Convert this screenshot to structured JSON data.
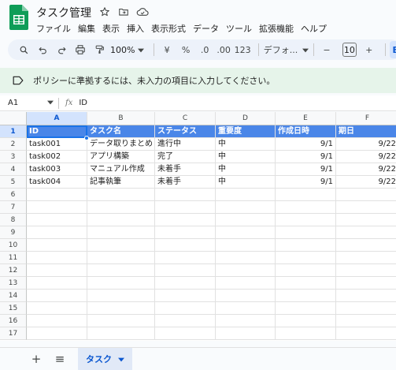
{
  "app": {
    "title": "タスク管理",
    "menu": [
      "ファイル",
      "編集",
      "表示",
      "挿入",
      "表示形式",
      "データ",
      "ツール",
      "拡張機能",
      "ヘルプ"
    ]
  },
  "toolbar": {
    "zoom": "100%",
    "currency": "¥",
    "percent": "%",
    "decrease_decimal": ".0",
    "increase_decimal": ".00",
    "number_format": "123",
    "font": "デフォ...",
    "font_size": "10",
    "minus": "−",
    "plus": "+",
    "bold": "B"
  },
  "notice": {
    "text": "ポリシーに準拠するには、未入力の項目に入力してください。"
  },
  "formula_bar": {
    "cell_ref": "A1",
    "fx": "fx",
    "content": "ID"
  },
  "grid": {
    "columns": [
      "A",
      "B",
      "C",
      "D",
      "E",
      "F"
    ],
    "rows": [
      "1",
      "2",
      "3",
      "4",
      "5",
      "6",
      "7",
      "8",
      "9",
      "10",
      "11",
      "12",
      "13",
      "14",
      "15",
      "16",
      "17"
    ],
    "header": [
      "ID",
      "タスク名",
      "ステータス",
      "重要度",
      "作成日時",
      "期日"
    ],
    "data": [
      [
        "task001",
        "データ取りまとめ",
        "進行中",
        "中",
        "9/1",
        "9/22"
      ],
      [
        "task002",
        "アプリ構築",
        "完了",
        "中",
        "9/1",
        "9/22"
      ],
      [
        "task003",
        "マニュアル作成",
        "未着手",
        "中",
        "9/1",
        "9/22"
      ],
      [
        "task004",
        "記事執筆",
        "未着手",
        "中",
        "9/1",
        "9/22"
      ]
    ]
  },
  "sheets": {
    "add": "+",
    "list": "≡",
    "active_tab": "タスク"
  },
  "colors": {
    "header_fill": "#4a86e8",
    "notice_bg": "#e6f4ea",
    "selection": "#1a73e8"
  }
}
